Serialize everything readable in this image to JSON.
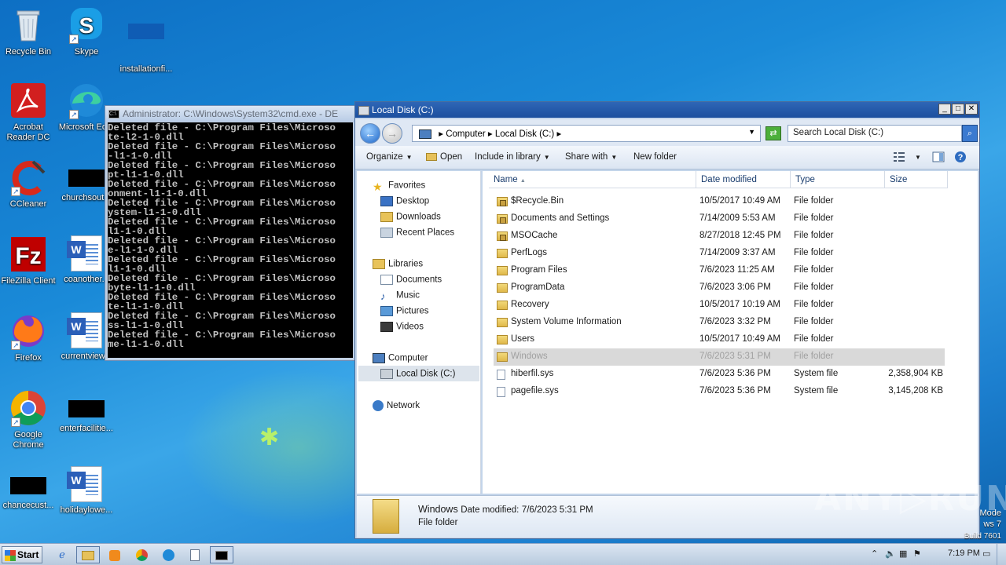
{
  "desktop": {
    "icons": [
      {
        "label": "Recycle Bin",
        "icon": "recycle-bin-icon"
      },
      {
        "label": "Skype",
        "icon": "skype-icon"
      },
      {
        "label": "installationfi...",
        "icon": "black-file-icon"
      },
      {
        "label": "Acrobat Reader DC",
        "icon": "acrobat-icon"
      },
      {
        "label": "Microsoft Ed...",
        "icon": "edge-icon"
      },
      {
        "label": "CCleaner",
        "icon": "ccleaner-icon"
      },
      {
        "label": "churchsout...",
        "icon": "black-file-icon"
      },
      {
        "label": "FileZilla Client",
        "icon": "filezilla-icon"
      },
      {
        "label": "coanother...",
        "icon": "word-doc-icon"
      },
      {
        "label": "Firefox",
        "icon": "firefox-icon"
      },
      {
        "label": "currentview...",
        "icon": "word-doc-icon"
      },
      {
        "label": "Google Chrome",
        "icon": "chrome-icon"
      },
      {
        "label": "enterfacilitie...",
        "icon": "black-file-icon"
      },
      {
        "label": "chancecust...",
        "icon": "black-file-icon"
      },
      {
        "label": "holidaylowe...",
        "icon": "word-doc-icon"
      }
    ]
  },
  "cmd": {
    "title": "Administrator: C:\\Windows\\System32\\cmd.exe - DE",
    "lines": [
      "Deleted file - C:\\Program Files\\Microso",
      "te-l2-1-0.dll",
      "Deleted file - C:\\Program Files\\Microso",
      "-l1-1-0.dll",
      "Deleted file - C:\\Program Files\\Microso",
      "pt-l1-1-0.dll",
      "Deleted file - C:\\Program Files\\Microso",
      "onment-l1-1-0.dll",
      "Deleted file - C:\\Program Files\\Microso",
      "ystem-l1-1-0.dll",
      "Deleted file - C:\\Program Files\\Microso",
      "l1-1-0.dll",
      "Deleted file - C:\\Program Files\\Microso",
      "e-l1-1-0.dll",
      "Deleted file - C:\\Program Files\\Microso",
      "l1-1-0.dll",
      "Deleted file - C:\\Program Files\\Microso",
      "byte-l1-1-0.dll",
      "Deleted file - C:\\Program Files\\Microso",
      "te-l1-1-0.dll",
      "Deleted file - C:\\Program Files\\Microso",
      "ss-l1-1-0.dll",
      "Deleted file - C:\\Program Files\\Microso",
      "me-l1-1-0.dll"
    ]
  },
  "explorer": {
    "title": "Local Disk (C:)",
    "address": {
      "computer": "Computer",
      "drive": "Local Disk (C:)"
    },
    "search_placeholder": "Search Local Disk (C:)",
    "toolbar": {
      "organize": "Organize",
      "open": "Open",
      "include": "Include in library",
      "share": "Share with",
      "new_folder": "New folder"
    },
    "nav": {
      "favorites": "Favorites",
      "desktop": "Desktop",
      "downloads": "Downloads",
      "recent": "Recent Places",
      "libraries": "Libraries",
      "documents": "Documents",
      "music": "Music",
      "pictures": "Pictures",
      "videos": "Videos",
      "computer": "Computer",
      "local_disk": "Local Disk (C:)",
      "network": "Network"
    },
    "columns": {
      "name": "Name",
      "date": "Date modified",
      "type": "Type",
      "size": "Size"
    },
    "rows": [
      {
        "name": "$Recycle.Bin",
        "date": "10/5/2017 10:49 AM",
        "type": "File folder",
        "size": "",
        "icon": "lock"
      },
      {
        "name": "Documents and Settings",
        "date": "7/14/2009 5:53 AM",
        "type": "File folder",
        "size": "",
        "icon": "lock"
      },
      {
        "name": "MSOCache",
        "date": "8/27/2018 12:45 PM",
        "type": "File folder",
        "size": "",
        "icon": "lock"
      },
      {
        "name": "PerfLogs",
        "date": "7/14/2009 3:37 AM",
        "type": "File folder",
        "size": "",
        "icon": "folder"
      },
      {
        "name": "Program Files",
        "date": "7/6/2023 11:25 AM",
        "type": "File folder",
        "size": "",
        "icon": "folder"
      },
      {
        "name": "ProgramData",
        "date": "7/6/2023 3:06 PM",
        "type": "File folder",
        "size": "",
        "icon": "folder"
      },
      {
        "name": "Recovery",
        "date": "10/5/2017 10:19 AM",
        "type": "File folder",
        "size": "",
        "icon": "folder"
      },
      {
        "name": "System Volume Information",
        "date": "7/6/2023 3:32 PM",
        "type": "File folder",
        "size": "",
        "icon": "folder"
      },
      {
        "name": "Users",
        "date": "10/5/2017 10:49 AM",
        "type": "File folder",
        "size": "",
        "icon": "folder"
      },
      {
        "name": "Windows",
        "date": "7/6/2023 5:31 PM",
        "type": "File folder",
        "size": "",
        "icon": "folder",
        "selected": true
      },
      {
        "name": "hiberfil.sys",
        "date": "7/6/2023 5:36 PM",
        "type": "System file",
        "size": "2,358,904 KB",
        "icon": "file"
      },
      {
        "name": "pagefile.sys",
        "date": "7/6/2023 5:36 PM",
        "type": "System file",
        "size": "3,145,208 KB",
        "icon": "file"
      }
    ],
    "details": {
      "name": "Windows",
      "date_label": "Date modified:",
      "date": "7/6/2023 5:31 PM",
      "type": "File folder"
    }
  },
  "watermark": {
    "text": "ANY▷RUN",
    "mode": "Mode",
    "ws7": "ws 7",
    "build": "Build 7601"
  },
  "taskbar": {
    "start": "Start",
    "time": "7:19 PM"
  }
}
